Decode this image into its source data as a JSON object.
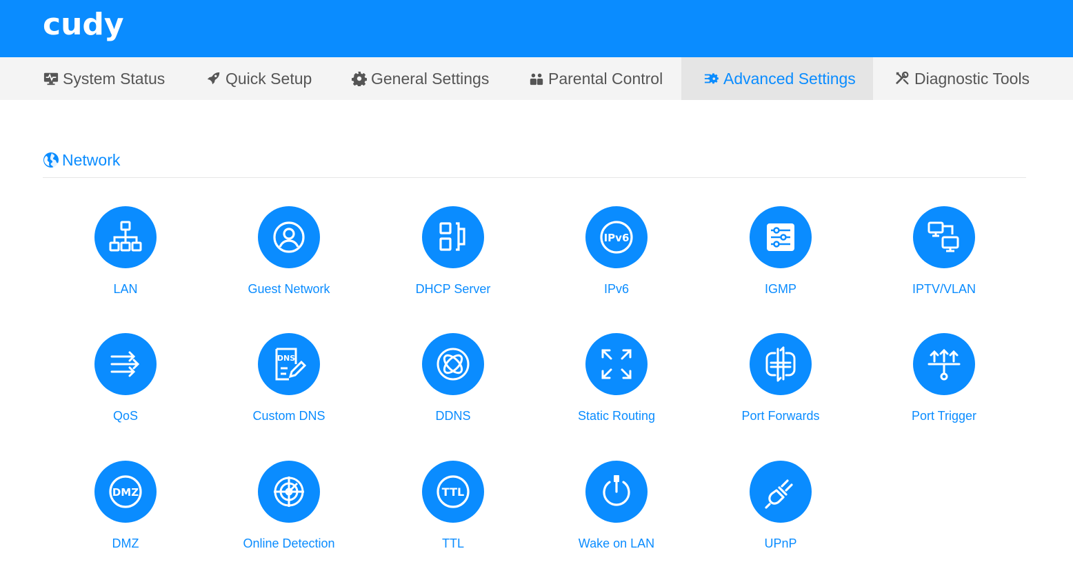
{
  "brand": {
    "logo_text": "cudy",
    "primary_color": "#0a8cff",
    "nav_bg": "#f4f4f4",
    "nav_active_bg": "#e5e5e5",
    "nav_text_color": "#555555"
  },
  "nav": {
    "items": [
      {
        "label": "System Status",
        "icon": "monitor-pulse-icon"
      },
      {
        "label": "Quick Setup",
        "icon": "rocket-icon"
      },
      {
        "label": "General Settings",
        "icon": "gear-icon"
      },
      {
        "label": "Parental Control",
        "icon": "users-icon"
      },
      {
        "label": "Advanced Settings",
        "icon": "sliders-gear-icon",
        "active": true
      },
      {
        "label": "Diagnostic Tools",
        "icon": "tools-icon"
      }
    ]
  },
  "section": {
    "title": "Network",
    "icon": "globe-icon"
  },
  "tiles": [
    {
      "label": "LAN",
      "icon": "lan-topology-icon"
    },
    {
      "label": "Guest Network",
      "icon": "guest-user-icon"
    },
    {
      "label": "DHCP Server",
      "icon": "dhcp-blocks-icon"
    },
    {
      "label": "IPv6",
      "icon": "ipv6-badge-icon",
      "icon_text": "IPv6"
    },
    {
      "label": "IGMP",
      "icon": "igmp-sliders-icon"
    },
    {
      "label": "IPTV/VLAN",
      "icon": "iptv-monitors-icon"
    },
    {
      "label": "QoS",
      "icon": "qos-arrows-icon"
    },
    {
      "label": "Custom DNS",
      "icon": "dns-document-icon",
      "icon_text": "DNS"
    },
    {
      "label": "DDNS",
      "icon": "ddns-globe-icon"
    },
    {
      "label": "Static Routing",
      "icon": "expand-arrows-icon"
    },
    {
      "label": "Port Forwards",
      "icon": "port-forward-icon"
    },
    {
      "label": "Port Trigger",
      "icon": "port-trigger-icon"
    },
    {
      "label": "DMZ",
      "icon": "dmz-badge-icon",
      "icon_text": "DMZ"
    },
    {
      "label": "Online Detection",
      "icon": "radar-target-icon"
    },
    {
      "label": "TTL",
      "icon": "ttl-badge-icon",
      "icon_text": "TTL"
    },
    {
      "label": "Wake on LAN",
      "icon": "power-plug-icon"
    },
    {
      "label": "UPnP",
      "icon": "plug-icon"
    }
  ]
}
